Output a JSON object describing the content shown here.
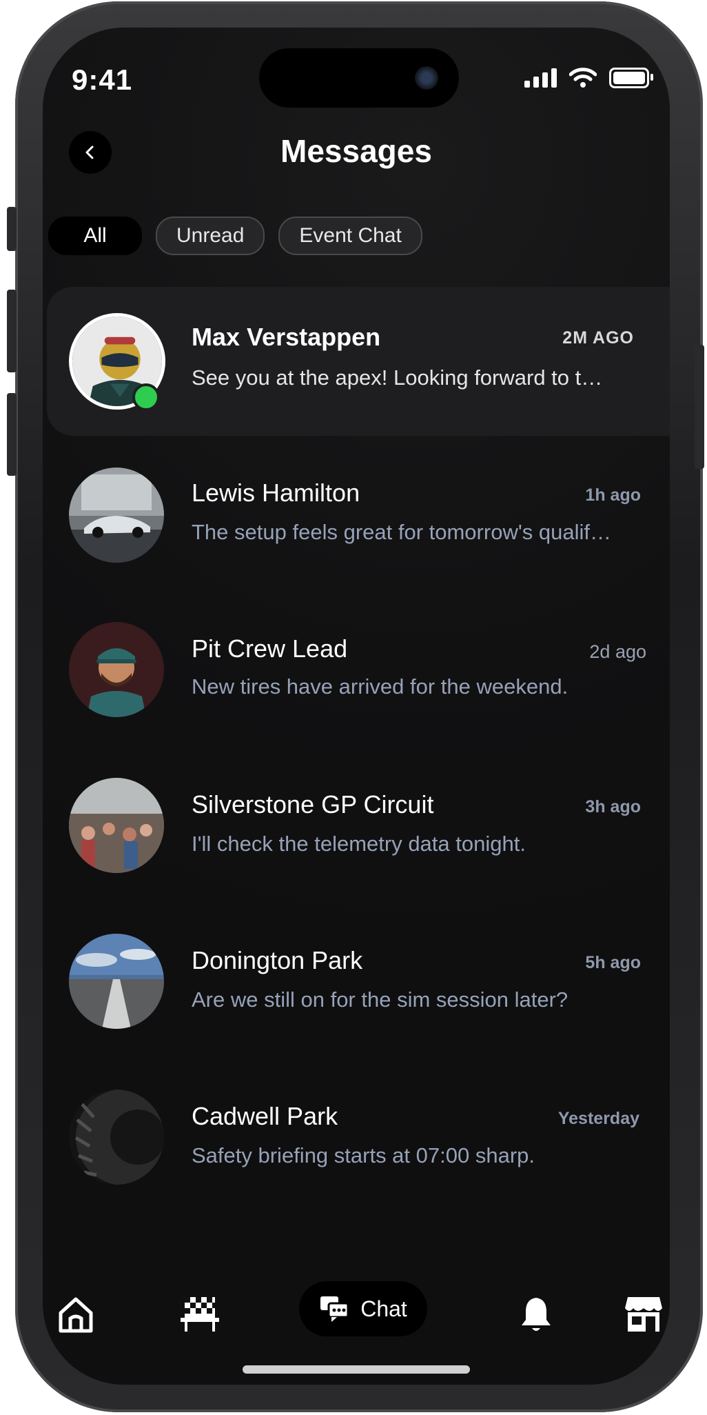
{
  "status": {
    "time": "9:41"
  },
  "header": {
    "title": "Messages"
  },
  "filters": [
    {
      "label": "All",
      "active": true
    },
    {
      "label": "Unread",
      "active": false
    },
    {
      "label": "Event Chat",
      "active": false
    }
  ],
  "threads": [
    {
      "name": "Max Verstappen",
      "time": "2M AGO",
      "message": "See you at the apex! Looking forward to the race this weekend.",
      "online": true,
      "avatar_icon": "racing-driver-avatar"
    },
    {
      "name": "Lewis Hamilton",
      "time": "1h ago",
      "message": "The setup feels great for tomorrow's qualifying session.",
      "avatar_icon": "sports-car-avatar"
    },
    {
      "name": "Pit Crew Lead",
      "time": "2d ago",
      "message": "New tires have arrived for the weekend.",
      "avatar_icon": "mechanic-avatar"
    },
    {
      "name": "Silverstone GP Circuit",
      "time": "3h ago",
      "message": "I'll check the telemetry data tonight.",
      "avatar_icon": "crowd-avatar"
    },
    {
      "name": "Donington Park",
      "time": "5h ago",
      "message": "Are we still on for the sim session later?",
      "avatar_icon": "road-avatar"
    },
    {
      "name": "Cadwell Park",
      "time": "Yesterday",
      "message": "Safety briefing starts at 07:00 sharp.",
      "avatar_icon": "tire-avatar"
    }
  ],
  "nav": {
    "items": [
      {
        "icon": "home-icon"
      },
      {
        "icon": "checkered-flag-icon"
      },
      {
        "icon": "chat-icon",
        "label": "Chat",
        "active": true
      },
      {
        "icon": "bell-icon"
      },
      {
        "icon": "store-icon"
      }
    ]
  },
  "colors": {
    "background": "#111112",
    "online": "#2ecc4f",
    "muted_text": "#97a2b8"
  }
}
